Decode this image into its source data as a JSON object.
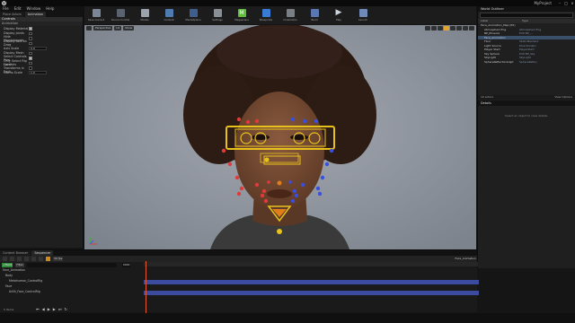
{
  "app": {
    "logo": "U",
    "project": "MyProject"
  },
  "menu": [
    "File",
    "Edit",
    "Window",
    "Help"
  ],
  "left_panel": {
    "tabs": [
      "Place Actors",
      "Animation"
    ],
    "section": "Controls",
    "subsection": "Animation",
    "rows": [
      {
        "label": "Display Material",
        "type": "check",
        "on": true
      },
      {
        "label": "Display Joints",
        "type": "check",
        "on": false
      },
      {
        "label": "Hide Morphtargets",
        "type": "check",
        "on": false
      },
      {
        "label": "Display Axis on Drag",
        "type": "check",
        "on": false
      },
      {
        "label": "Axis Scale",
        "type": "input",
        "value": "0.0"
      },
      {
        "label": "Display Mesh",
        "type": "check",
        "on": false
      },
      {
        "label": "Select Controls Pers",
        "type": "check",
        "on": true
      },
      {
        "label": "Only Select Rig Controls",
        "type": "check",
        "on": false
      },
      {
        "label": "Local Transforms in Each",
        "type": "check",
        "on": false
      },
      {
        "label": "Gizmo Scale",
        "type": "input",
        "value": "1.0"
      }
    ]
  },
  "toolbar": {
    "buttons": [
      {
        "label": "Save Current",
        "icon": "save-icon",
        "color": "#7b8796"
      },
      {
        "label": "Source Control",
        "icon": "source-control-icon",
        "color": "#5a6270"
      },
      {
        "label": "Modes",
        "icon": "modes-icon",
        "color": "#9aa3ad"
      },
      {
        "label": "Content",
        "icon": "content-icon",
        "color": "#4f7bb0"
      },
      {
        "label": "Marketplace",
        "icon": "marketplace-icon",
        "color": "#3f5d8f"
      },
      {
        "label": "Settings",
        "icon": "settings-icon",
        "color": "#8a8f96"
      },
      {
        "label": "Megascans",
        "icon": "megascans-icon",
        "color": "#5fbf3c"
      },
      {
        "label": "Blueprints",
        "icon": "blueprints-icon",
        "color": "#3a7bd5"
      },
      {
        "label": "Cinematics",
        "icon": "cinematics-icon",
        "color": "#7a7f86"
      },
      {
        "label": "Build",
        "icon": "build-icon",
        "color": "#5a78b0"
      },
      {
        "label": "Play",
        "icon": "play-icon",
        "color": "#cfd6df"
      },
      {
        "label": "Launch",
        "icon": "launch-icon",
        "color": "#6f8ab8"
      }
    ]
  },
  "viewport": {
    "buttons": [
      "",
      "Perspective",
      "Lit",
      "Show"
    ]
  },
  "world_outliner": {
    "title": "World Outliner",
    "columns": [
      "Label",
      "Type"
    ],
    "items": [
      {
        "name": "Face_Animation_Map (Ed)",
        "type": "",
        "sel": false
      },
      {
        "name": "AtmosphericFog",
        "type": "AtmosphericFog",
        "sel": false
      },
      {
        "name": "BP_Phoenix",
        "type": "Edit BP_...",
        "sel": false
      },
      {
        "name": "Face_Animation",
        "type": "",
        "sel": true
      },
      {
        "name": "Floor",
        "type": "StaticMeshAct",
        "sel": false
      },
      {
        "name": "Light Source",
        "type": "DirectionalLi",
        "sel": false
      },
      {
        "name": "Player Start",
        "type": "PlayerStart",
        "sel": false
      },
      {
        "name": "Sky Sphere",
        "type": "Edit BP_Sky",
        "sel": false
      },
      {
        "name": "SkyLight",
        "type": "SkyLight",
        "sel": false
      },
      {
        "name": "SphereReflectionCapt",
        "type": "SphereReflec",
        "sel": false
      }
    ],
    "footer": "10 actors",
    "view_options": "View Options"
  },
  "details": {
    "title": "Details",
    "empty": "Select an object to view details."
  },
  "bottom": {
    "tabs": [
      "Content Browser",
      "Sequencer"
    ],
    "track_label": "+Track",
    "filter": "Filter",
    "seq_name": "Face_Animation",
    "fps": "30 fps",
    "time": "0000",
    "tracks": [
      "Face_Animation",
      "Body",
      "Metahuman_ControlRig",
      "Face",
      "ArKit_Face_ControlRig"
    ],
    "items_count": "5 Items"
  }
}
